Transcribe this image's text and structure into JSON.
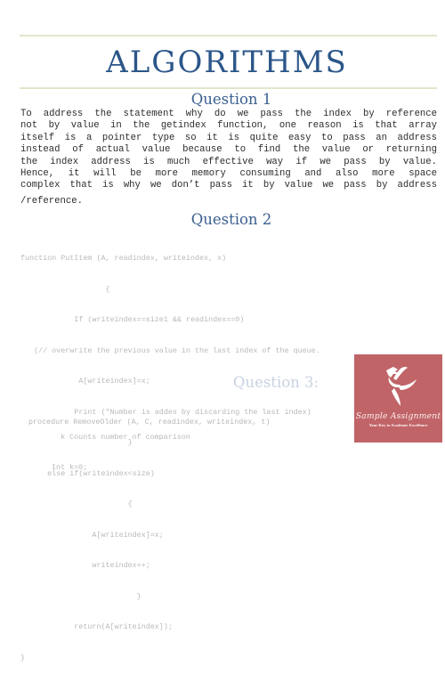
{
  "document": {
    "title": "ALGORITHMS",
    "question1": {
      "heading": "Question 1",
      "lines": [
        "To address the statement why do we pass the index by reference",
        "not by value in the getindex function, one reason is that array",
        "itself is a pointer type so it is quite easy to pass an address",
        "instead of actual value because to find the value or returning",
        "the index address is much effective way if we pass by value.",
        "Hence, it will be more memory consuming and also more space",
        "complex that is why we don’t pass it by value we pass by address"
      ],
      "last_line": "/reference."
    },
    "question2": {
      "heading": "Question 2",
      "code_lines": [
        "function PutItem (A, readindex, writeindex, x)",
        "                   {",
        "            If (writeindex==size1 && readindex==0)",
        "   (// overwrite the previous value in the last index of the queue.",
        "             A[writeindex]=x;",
        "            Print (\"Number is addes by discarding the last index)",
        "                        }",
        "      else if(writeindex<size)",
        "                        {",
        "                A[writeindex]=x;",
        "                writeindex++;",
        "                          }",
        "            return(A[writeindex]);",
        "}"
      ]
    },
    "question3": {
      "heading": "Question 3:",
      "code_lines": [
        "procedure RemoveOlder (A, C, readindex, writeindex, t)"
      ],
      "code_lines_2": [
        "   k Counts number of comparison",
        " Int k=0;"
      ]
    }
  },
  "logo": {
    "brand": "Sample Assignment",
    "tagline": "Your Key to Academic Excellence",
    "background_color": "#c06467",
    "icon": "dancing-figure-icon"
  }
}
